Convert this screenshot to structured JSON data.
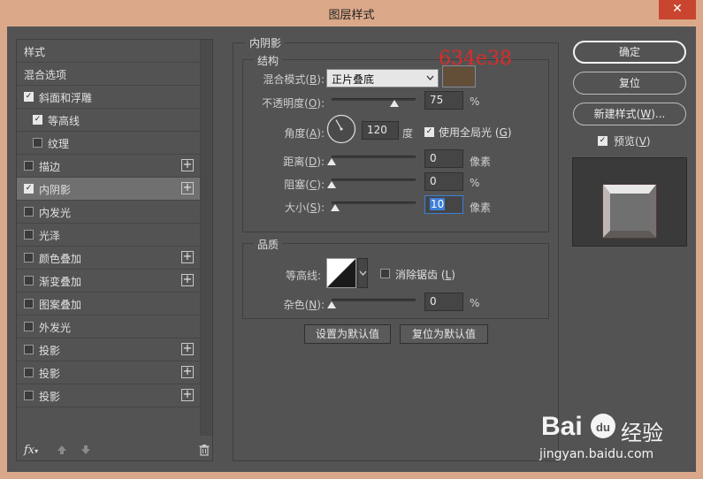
{
  "window": {
    "title": "图层样式",
    "close_symbol": "✕"
  },
  "left": {
    "items": [
      {
        "label": "样式",
        "has_checkbox": false,
        "checked": false,
        "has_plus": false,
        "selected": false,
        "indent": 0
      },
      {
        "label": "混合选项",
        "has_checkbox": false,
        "checked": false,
        "has_plus": false,
        "selected": false,
        "indent": 0
      },
      {
        "label": "斜面和浮雕",
        "has_checkbox": true,
        "checked": true,
        "has_plus": false,
        "selected": false,
        "indent": 0
      },
      {
        "label": "等高线",
        "has_checkbox": true,
        "checked": true,
        "has_plus": false,
        "selected": false,
        "indent": 1
      },
      {
        "label": "纹理",
        "has_checkbox": true,
        "checked": false,
        "has_plus": false,
        "selected": false,
        "indent": 1
      },
      {
        "label": "描边",
        "has_checkbox": true,
        "checked": false,
        "has_plus": true,
        "selected": false,
        "indent": 0
      },
      {
        "label": "内阴影",
        "has_checkbox": true,
        "checked": true,
        "has_plus": true,
        "selected": true,
        "indent": 0
      },
      {
        "label": "内发光",
        "has_checkbox": true,
        "checked": false,
        "has_plus": false,
        "selected": false,
        "indent": 0
      },
      {
        "label": "光泽",
        "has_checkbox": true,
        "checked": false,
        "has_plus": false,
        "selected": false,
        "indent": 0
      },
      {
        "label": "颜色叠加",
        "has_checkbox": true,
        "checked": false,
        "has_plus": true,
        "selected": false,
        "indent": 0
      },
      {
        "label": "渐变叠加",
        "has_checkbox": true,
        "checked": false,
        "has_plus": true,
        "selected": false,
        "indent": 0
      },
      {
        "label": "图案叠加",
        "has_checkbox": true,
        "checked": false,
        "has_plus": false,
        "selected": false,
        "indent": 0
      },
      {
        "label": "外发光",
        "has_checkbox": true,
        "checked": false,
        "has_plus": false,
        "selected": false,
        "indent": 0
      },
      {
        "label": "投影",
        "has_checkbox": true,
        "checked": false,
        "has_plus": true,
        "selected": false,
        "indent": 0
      },
      {
        "label": "投影",
        "has_checkbox": true,
        "checked": false,
        "has_plus": true,
        "selected": false,
        "indent": 0
      },
      {
        "label": "投影",
        "has_checkbox": true,
        "checked": false,
        "has_plus": true,
        "selected": false,
        "indent": 0
      }
    ],
    "fx_label": "fx",
    "fx_suffix": "▾"
  },
  "inner_shadow": {
    "section_title": "内阴影",
    "structure": {
      "title": "结构",
      "blend_mode_label": "混合模式(",
      "blend_mode_key": "B",
      "blend_mode_value": "正片叠底",
      "color_hex_annotation": "634e38",
      "swatch_color": "#634e38",
      "opacity_label": "不透明度(",
      "opacity_key": "O",
      "opacity_value": "75",
      "opacity_fraction": 0.75,
      "percent": "%",
      "angle_label": "角度(",
      "angle_key": "A",
      "angle_value": "120",
      "angle_degrees": 120,
      "degree_unit": "度",
      "global_light_label": "使用全局光 (",
      "global_light_key": "G",
      "global_light_checked": true,
      "distance_label": "距离(",
      "distance_key": "D",
      "distance_value": "0",
      "distance_fraction": 0.0,
      "pixel_unit": "像素",
      "choke_label": "阻塞(",
      "choke_key": "C",
      "choke_value": "0",
      "choke_fraction": 0.0,
      "size_label": "大小(",
      "size_key": "S",
      "size_value": "10",
      "size_fraction": 0.04,
      "close_paren": "):",
      "close_paren_plain": ")"
    },
    "quality": {
      "title": "品质",
      "contour_label": "等高线:",
      "anti_alias_label": "消除锯齿 (",
      "anti_alias_key": "L",
      "anti_alias_checked": false,
      "noise_label": "杂色(",
      "noise_key": "N",
      "noise_value": "0",
      "noise_fraction": 0.0
    },
    "set_default_label": "设置为默认值",
    "reset_default_label": "复位为默认值"
  },
  "right": {
    "ok_label": "确定",
    "reset_label": "复位",
    "new_style_label": "新建样式(",
    "new_style_key": "W",
    "new_style_suffix": ")...",
    "preview_label": "预览(",
    "preview_key": "V",
    "preview_checked": true
  },
  "watermark": {
    "brand": "Bai",
    "paw": "du",
    "site_name": "经验",
    "url": "jingyan.baidu.com"
  }
}
